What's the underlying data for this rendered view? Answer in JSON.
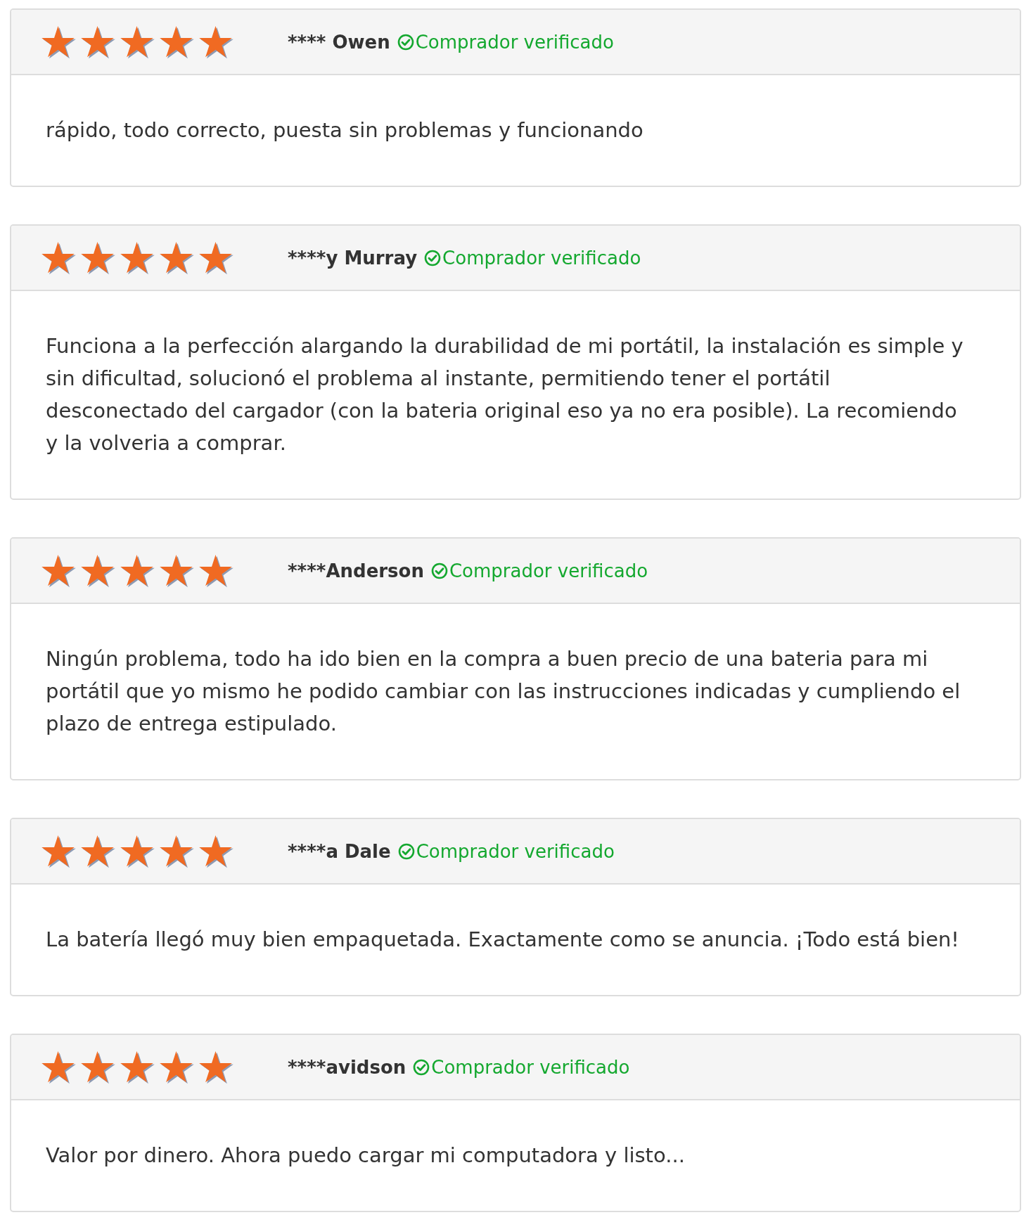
{
  "reviews": [
    {
      "stars": 5,
      "author": "**** Owen",
      "verified": true,
      "verified_label": "Comprador verificado",
      "text": "rápido, todo correcto, puesta sin problemas y funcionando"
    },
    {
      "stars": 5,
      "author": "****y Murray",
      "verified": true,
      "verified_label": "Comprador verificado",
      "text": "Funciona a la perfección alargando la durabilidad de mi portátil, la instalación es simple y sin dificultad, solucionó el problema al instante, permitiendo tener el portátil desconectado del cargador (con la bateria original eso ya no era posible). La recomiendo y la volveria a comprar."
    },
    {
      "stars": 5,
      "author": "****Anderson",
      "verified": true,
      "verified_label": "Comprador verificado",
      "text": "Ningún problema, todo ha ido bien en la compra a buen precio de una bateria para mi portátil que yo mismo he podido cambiar con las instrucciones indicadas y cumpliendo el plazo de entrega estipulado."
    },
    {
      "stars": 5,
      "author": "****a Dale",
      "verified": true,
      "verified_label": "Comprador verificado",
      "text": "La batería llegó muy bien empaquetada. Exactamente como se anuncia. ¡Todo está bien!"
    },
    {
      "stars": 5,
      "author": "****avidson",
      "verified": true,
      "verified_label": "Comprador verificado",
      "text": "Valor por dinero. Ahora puedo cargar mi computadora y listo..."
    }
  ]
}
